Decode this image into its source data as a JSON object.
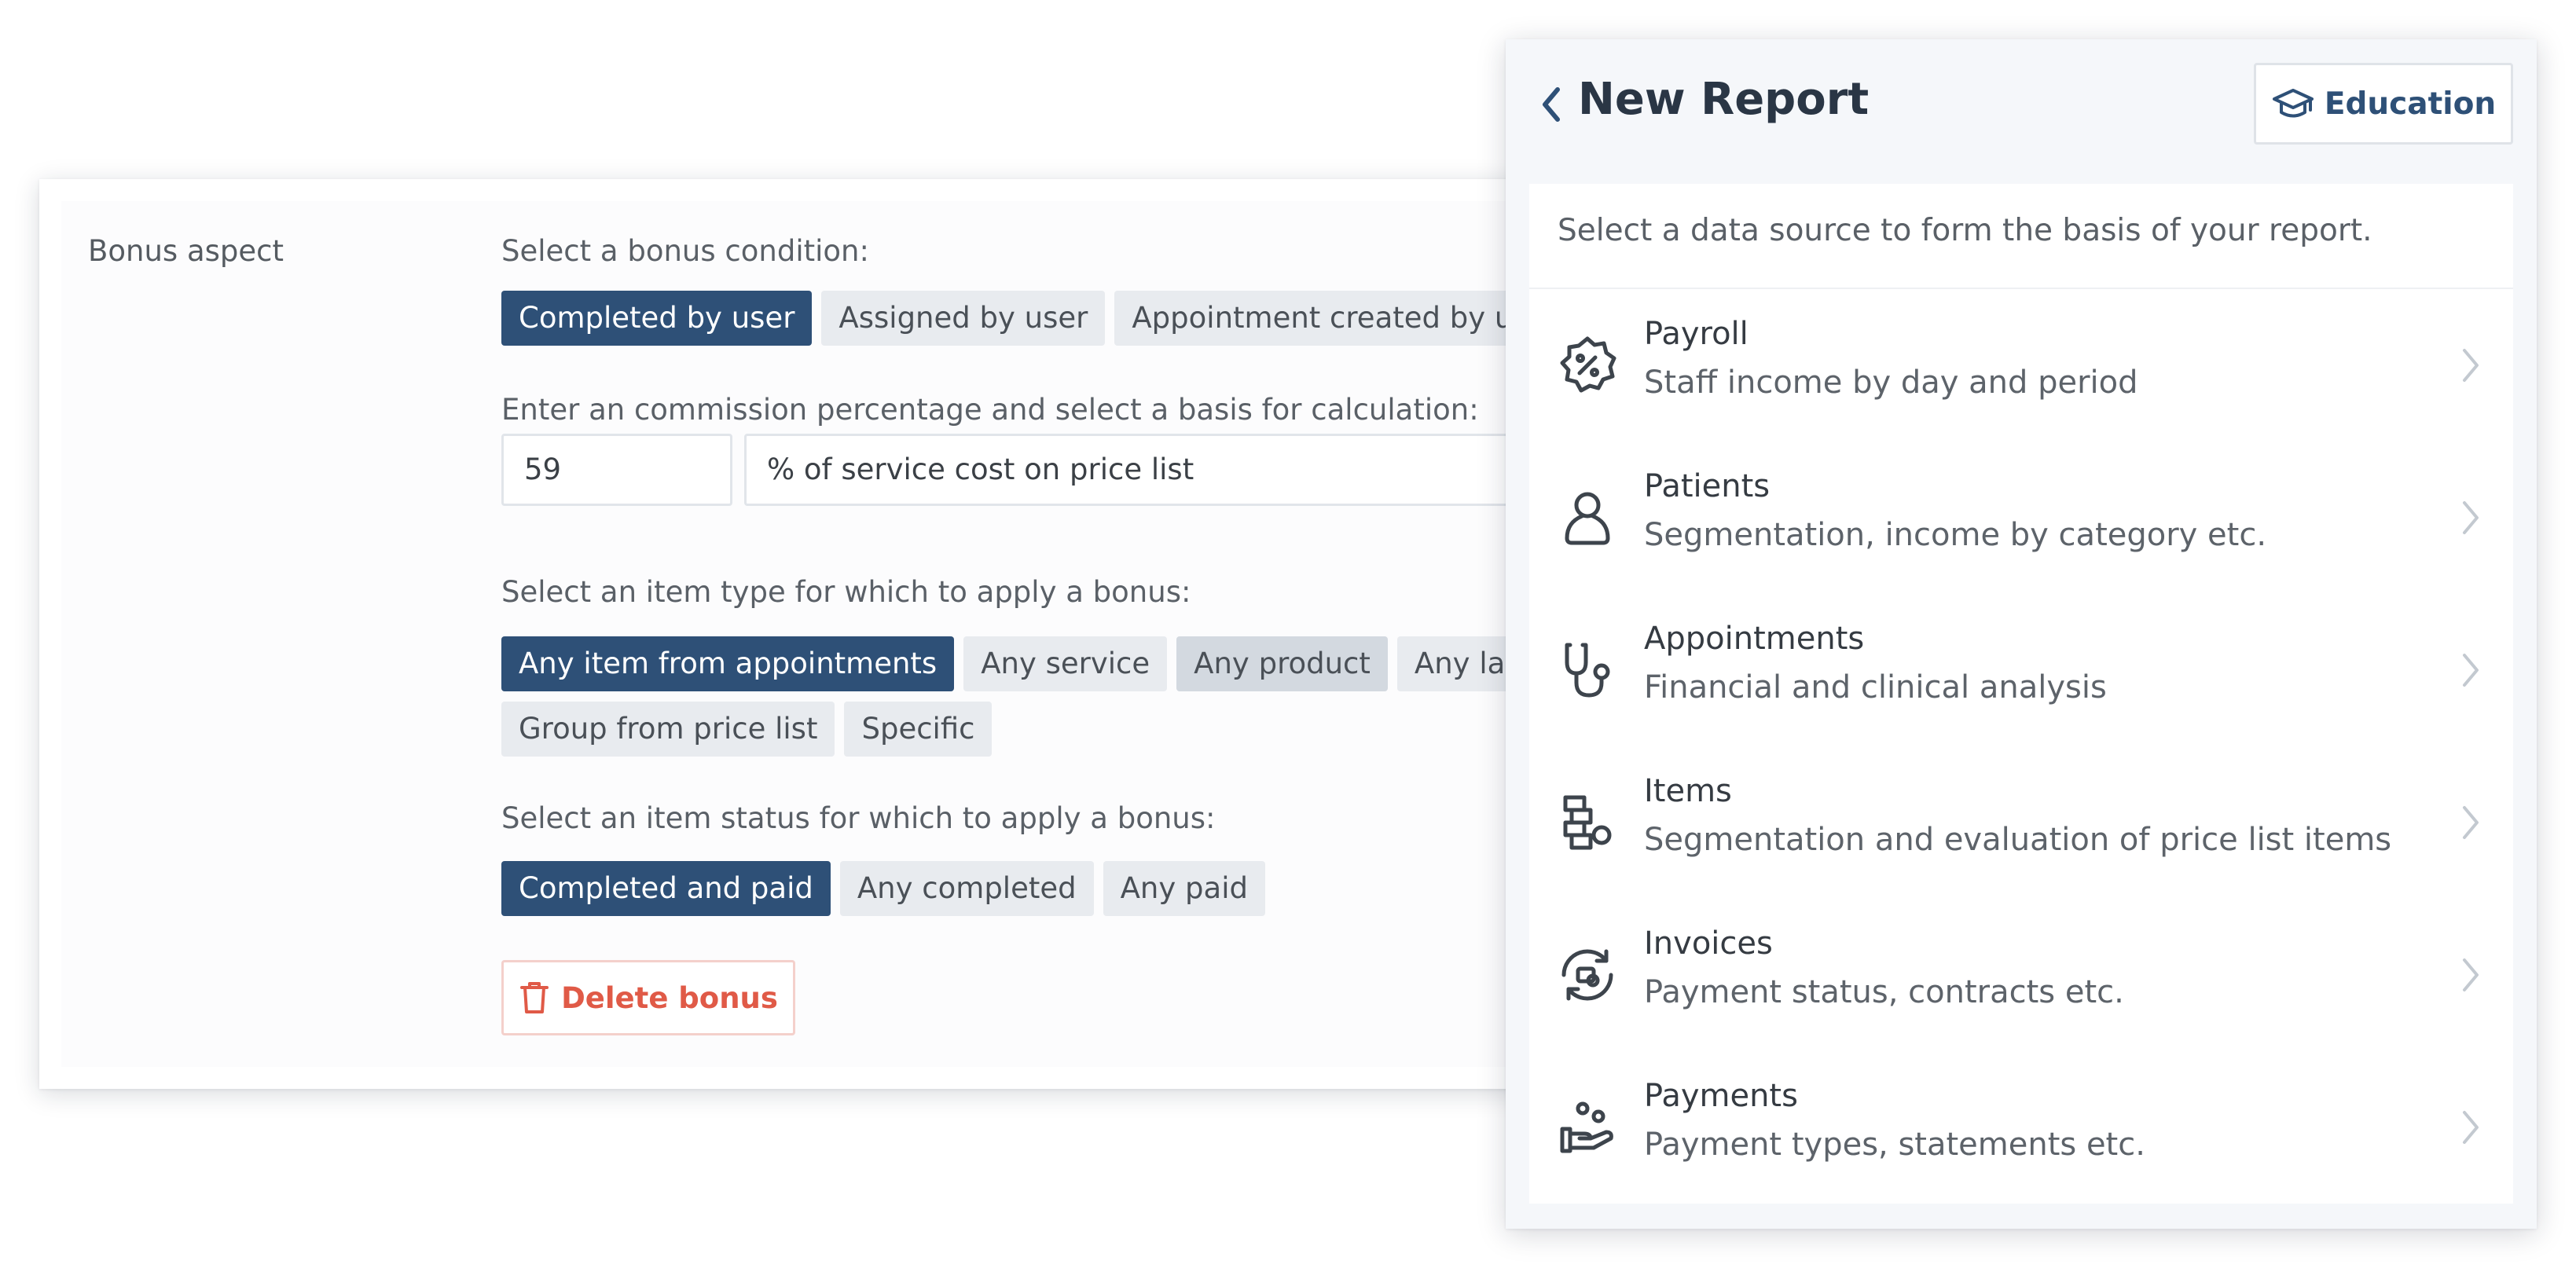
{
  "bonus": {
    "aspect_label": "Bonus aspect",
    "condition_label": "Select a bonus condition:",
    "conditions": [
      "Completed by user",
      "Assigned by user",
      "Appointment created by user"
    ],
    "commission_label": "Enter an commission percentage and select a basis for calculation:",
    "percentage_value": "59",
    "basis_value": "% of service cost on price list",
    "item_type_label": "Select an item type for which to apply a bonus:",
    "item_types_row1": [
      "Any item from appointments",
      "Any service",
      "Any product",
      "Any lab"
    ],
    "item_types_row2": [
      "Group from price list",
      "Specific"
    ],
    "status_label": "Select an item status for which to apply a bonus:",
    "statuses": [
      "Completed and paid",
      "Any completed",
      "Any paid"
    ],
    "delete_label": "Delete bonus"
  },
  "report": {
    "title": "New Report",
    "education_label": "Education",
    "description": "Select a data source to form the basis of your report.",
    "items": [
      {
        "title": "Payroll",
        "subtitle": "Staff income by day and period",
        "icon": "percent-badge-icon"
      },
      {
        "title": "Patients",
        "subtitle": "Segmentation, income by category etc.",
        "icon": "person-icon"
      },
      {
        "title": "Appointments",
        "subtitle": "Financial and clinical analysis",
        "icon": "stethoscope-icon"
      },
      {
        "title": "Items",
        "subtitle": "Segmentation and evaluation of price list items",
        "icon": "items-icon"
      },
      {
        "title": "Invoices",
        "subtitle": "Payment status, contracts etc.",
        "icon": "invoice-cycle-icon"
      },
      {
        "title": "Payments",
        "subtitle": "Payment types, statements etc.",
        "icon": "hand-coins-icon"
      }
    ]
  },
  "colors": {
    "primary": "#2e5077",
    "chip": "#e8ebef",
    "chip_hover": "#d3d9e0",
    "danger": "#e05a47"
  }
}
